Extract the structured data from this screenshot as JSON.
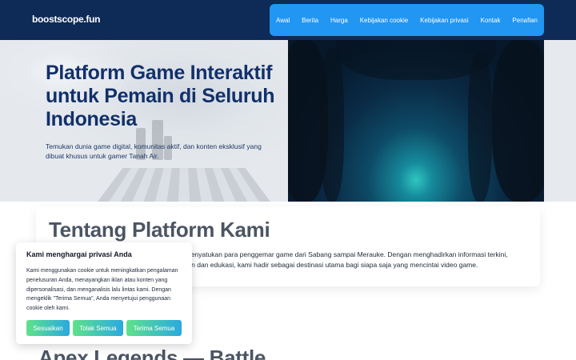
{
  "header": {
    "logo": "boostscope.fun",
    "nav": [
      "Awal",
      "Berita",
      "Harga",
      "Kebijakan cookie",
      "Kebijakan privasi",
      "Kontak",
      "Penafian"
    ]
  },
  "hero": {
    "title": "Platform Game Interaktif untuk Pemain di Seluruh Indonesia",
    "subtitle": "Temukan dunia game digital, komunitas aktif, dan konten eksklusif yang dibuat khusus untuk gamer Tanah Air."
  },
  "about": {
    "title": "Tentang Platform Kami",
    "line1": "k menyatukan para penggemar game dari Sabang sampai Merauke. Dengan menghadirkan informasi terkini,",
    "line2": "luran dan edukasi, kami hadir sebagai destinasi utama bagi siapa saja yang mencintai video game."
  },
  "next_section": {
    "title": "Apex Legends — Battle"
  },
  "cookie": {
    "title": "Kami menghargai privasi Anda",
    "text": "Kami menggunakan cookie untuk meningkatkan pengalaman penelusuran Anda, menayangkan iklan atau konten yang dipersonalisasi, dan menganalisis lalu lintas kami. Dengan mengeklik \"Terima Semua\", Anda menyetujui penggunaan cookie oleh kami.",
    "buttons": {
      "customize": "Sesuaikan",
      "reject": "Tolak Semua",
      "accept": "Terima Semua"
    }
  },
  "colors": {
    "header_bg": "#0e2a56",
    "nav_bg": "#2196f3",
    "title_blue": "#12306a"
  }
}
